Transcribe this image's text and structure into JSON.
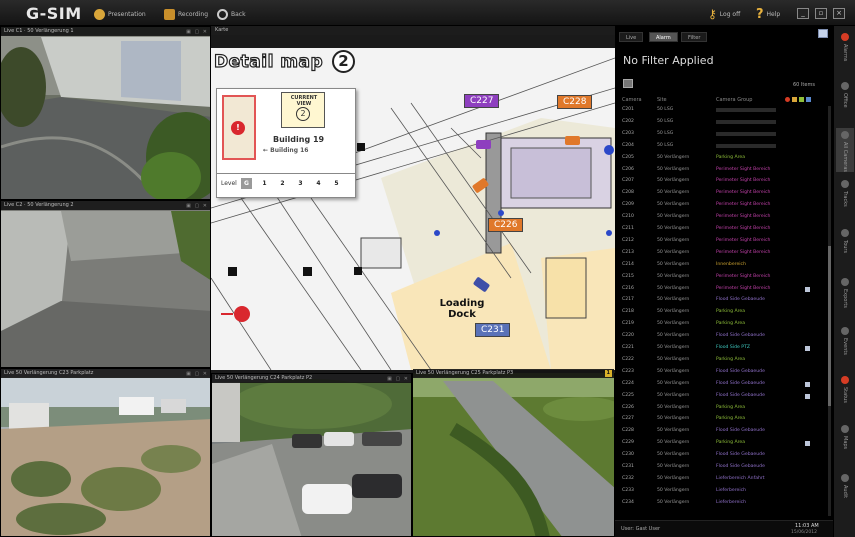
{
  "app": {
    "title": "G-SIM",
    "toolbar": [
      {
        "label": "Presentation",
        "icon": "gear-icon"
      },
      {
        "label": "Recording",
        "icon": "layout-icon"
      },
      {
        "label": "Back",
        "icon": "back-circle-icon"
      }
    ],
    "logout_label": "Log off",
    "help_label": "Help"
  },
  "cameras": [
    {
      "id": "tile-road-1",
      "title": "Live  C1 · 50 Verlängerung 1"
    },
    {
      "id": "tile-road-2",
      "title": "Live  C2 · 50 Verlängerung 2"
    },
    {
      "id": "tile-parking-1",
      "title": "Live  50 Verlängerung C23 Parkplatz"
    },
    {
      "id": "tile-parking-2",
      "title": "Live  50 Verlängerung C24 Parkplatz P2"
    },
    {
      "id": "tile-lawn",
      "title": "Live  50 Verlängerung C25 Parkplatz P3",
      "badge": "1"
    }
  ],
  "map": {
    "frame_title": "Karte",
    "title": "Detail map",
    "number": "2",
    "inset": {
      "current_view": "CURRENT VIEW",
      "building_main": "Building 19",
      "building_sub": "← Building 16",
      "level_label": "Level",
      "levels": [
        "G",
        "1",
        "2",
        "3",
        "4",
        "5"
      ]
    },
    "cameras": [
      {
        "label": "C227",
        "color": "#8e3fbf"
      },
      {
        "label": "C228",
        "color": "#e0782a"
      },
      {
        "label": "C226",
        "color": "#e0782a"
      },
      {
        "label": "C231",
        "color": "#5a72b8"
      }
    ],
    "loading_dock": "Loading Dock"
  },
  "right_panel": {
    "tabs": [
      "Live",
      "Alarm",
      "Filter"
    ],
    "active_tab": "Alarm",
    "filter_title": "No Filter Applied",
    "count_label": "60 Items",
    "columns": [
      "Camera",
      "Site",
      "Camera Group"
    ],
    "rows": [
      {
        "cam": "C201",
        "site": "50 LSG",
        "group": "",
        "color": "#777",
        "flag": false
      },
      {
        "cam": "C202",
        "site": "50 LSG",
        "group": "",
        "color": "#777",
        "flag": false
      },
      {
        "cam": "C203",
        "site": "50 LSG",
        "group": "",
        "color": "#777",
        "flag": false
      },
      {
        "cam": "C204",
        "site": "50 LSG",
        "group": "",
        "color": "#777",
        "flag": false
      },
      {
        "cam": "C205",
        "site": "50 Verlängern",
        "group": "Parking Area",
        "color": "#8fbf3a",
        "flag": false
      },
      {
        "cam": "C206",
        "site": "50 Verlängern",
        "group": "Perimeter Sight Bereich",
        "color": "#c040a8",
        "flag": false
      },
      {
        "cam": "C207",
        "site": "50 Verlängern",
        "group": "Perimeter Sight Bereich",
        "color": "#c040a8",
        "flag": false
      },
      {
        "cam": "C208",
        "site": "50 Verlängern",
        "group": "Perimeter Sight Bereich",
        "color": "#c040a8",
        "flag": false
      },
      {
        "cam": "C209",
        "site": "50 Verlängern",
        "group": "Perimeter Sight Bereich",
        "color": "#c040a8",
        "flag": false
      },
      {
        "cam": "C210",
        "site": "50 Verlängern",
        "group": "Perimeter Sight Bereich",
        "color": "#c040a8",
        "flag": false
      },
      {
        "cam": "C211",
        "site": "50 Verlängern",
        "group": "Perimeter Sight Bereich",
        "color": "#c040a8",
        "flag": false
      },
      {
        "cam": "C212",
        "site": "50 Verlängern",
        "group": "Perimeter Sight Bereich",
        "color": "#c040a8",
        "flag": false
      },
      {
        "cam": "C213",
        "site": "50 Verlängern",
        "group": "Perimeter Sight Bereich",
        "color": "#c040a8",
        "flag": false
      },
      {
        "cam": "C214",
        "site": "50 Verlängern",
        "group": "Innenbereich",
        "color": "#c9a030",
        "flag": false
      },
      {
        "cam": "C215",
        "site": "50 Verlängern",
        "group": "Perimeter Sight Bereich",
        "color": "#c040a8",
        "flag": false
      },
      {
        "cam": "C216",
        "site": "50 Verlängern",
        "group": "Perimeter Sight Bereich",
        "color": "#c040a8",
        "flag": true
      },
      {
        "cam": "C217",
        "site": "50 Verlängern",
        "group": "Flood Side Gebaeude",
        "color": "#8f70c8",
        "flag": false
      },
      {
        "cam": "C218",
        "site": "50 Verlängern",
        "group": "Parking Area",
        "color": "#8fbf3a",
        "flag": false
      },
      {
        "cam": "C219",
        "site": "50 Verlängern",
        "group": "Parking Area",
        "color": "#8fbf3a",
        "flag": false
      },
      {
        "cam": "C220",
        "site": "50 Verlängern",
        "group": "Flood Side Gebaeude",
        "color": "#8f70c8",
        "flag": false
      },
      {
        "cam": "C221",
        "site": "50 Verlängern",
        "group": "Flood Side PTZ",
        "color": "#3fc9c0",
        "flag": true
      },
      {
        "cam": "C222",
        "site": "50 Verlängern",
        "group": "Parking Area",
        "color": "#8fbf3a",
        "flag": false
      },
      {
        "cam": "C223",
        "site": "50 Verlängern",
        "group": "Flood Side Gebaeude",
        "color": "#8f70c8",
        "flag": false
      },
      {
        "cam": "C224",
        "site": "50 Verlängern",
        "group": "Flood Side Gebaeude",
        "color": "#8f70c8",
        "flag": true
      },
      {
        "cam": "C225",
        "site": "50 Verlängern",
        "group": "Flood Side Gebaeude",
        "color": "#8f70c8",
        "flag": true
      },
      {
        "cam": "C226",
        "site": "50 Verlängern",
        "group": "Parking Area",
        "color": "#8fbf3a",
        "flag": false
      },
      {
        "cam": "C227",
        "site": "50 Verlängern",
        "group": "Parking Area",
        "color": "#8fbf3a",
        "flag": false
      },
      {
        "cam": "C228",
        "site": "50 Verlängern",
        "group": "Flood Side Gebaeude",
        "color": "#8f70c8",
        "flag": false
      },
      {
        "cam": "C229",
        "site": "50 Verlängern",
        "group": "Parking Area",
        "color": "#8fbf3a",
        "flag": true
      },
      {
        "cam": "C230",
        "site": "50 Verlängern",
        "group": "Flood Side Gebaeude",
        "color": "#8f70c8",
        "flag": false
      },
      {
        "cam": "C231",
        "site": "50 Verlängern",
        "group": "Flood Side Gebaeude",
        "color": "#8f70c8",
        "flag": false
      },
      {
        "cam": "C232",
        "site": "50 Verlängern",
        "group": "Lieferbereich Anfahrt",
        "color": "#8f70c8",
        "flag": false
      },
      {
        "cam": "C233",
        "site": "50 Verlängern",
        "group": "Lieferbereich",
        "color": "#8f70c8",
        "flag": false
      },
      {
        "cam": "C234",
        "site": "50 Verlängern",
        "group": "Lieferbereich",
        "color": "#8f70c8",
        "flag": false
      }
    ],
    "status_user": "User: Gast User",
    "status_time": "11:03 AM",
    "status_date": "15/06/2012"
  },
  "sidebar": [
    {
      "label": "Alarms",
      "red": true
    },
    {
      "label": "Office",
      "red": false
    },
    {
      "label": "All Cameras",
      "red": false,
      "active": true
    },
    {
      "label": "Tracks",
      "red": false
    },
    {
      "label": "Tours",
      "red": false
    },
    {
      "label": "Exports",
      "red": false
    },
    {
      "label": "Events",
      "red": false
    },
    {
      "label": "Status",
      "red": true
    },
    {
      "label": "Maps",
      "red": false
    },
    {
      "label": "Audit",
      "red": false
    }
  ]
}
